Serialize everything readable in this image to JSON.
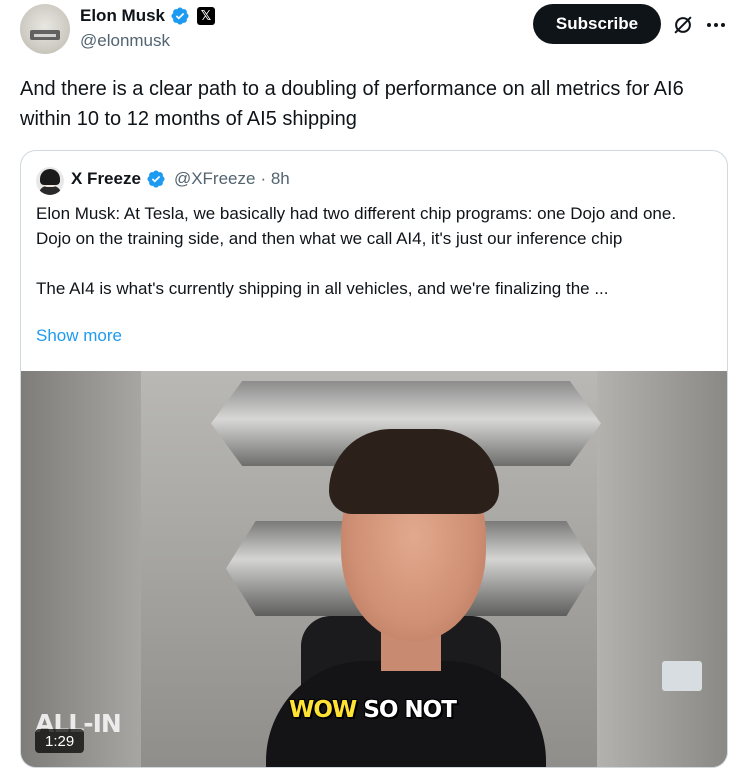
{
  "author": {
    "name": "Elon Musk",
    "handle": "@elonmusk",
    "verified_icon": "verified-badge-icon",
    "affiliation_icon": "x-logo-icon",
    "affiliation_glyph": "𝕏"
  },
  "header": {
    "subscribe_label": "Subscribe",
    "grok_icon": "grok-icon",
    "more_icon": "more-icon"
  },
  "tweet": {
    "text": "And there is a clear path to a doubling of performance on all metrics for AI6 within 10 to 12 months of AI5 shipping"
  },
  "quote": {
    "name": "X Freeze",
    "handle": "@XFreeze",
    "time": "· 8h",
    "paragraph1": "Elon Musk: At Tesla, we basically had two different chip programs: one Dojo and one. Dojo on the training side, and then what we call AI4, it's just our inference chip",
    "paragraph2": "The AI4 is what's currently shipping in all vehicles, and we're finalizing the ...",
    "show_more": "Show more",
    "video": {
      "caption_highlight": "WOW",
      "caption_rest": "SO NOT",
      "watermark": "ALL-IN",
      "duration": "1:29"
    }
  },
  "colors": {
    "link": "#1d9bf0",
    "verified": "#1d9bf0",
    "text": "#0f1419",
    "muted": "#536471",
    "subscribe_bg": "#0f1419",
    "border": "#cfd9de",
    "caption_highlight": "#ffe234"
  }
}
